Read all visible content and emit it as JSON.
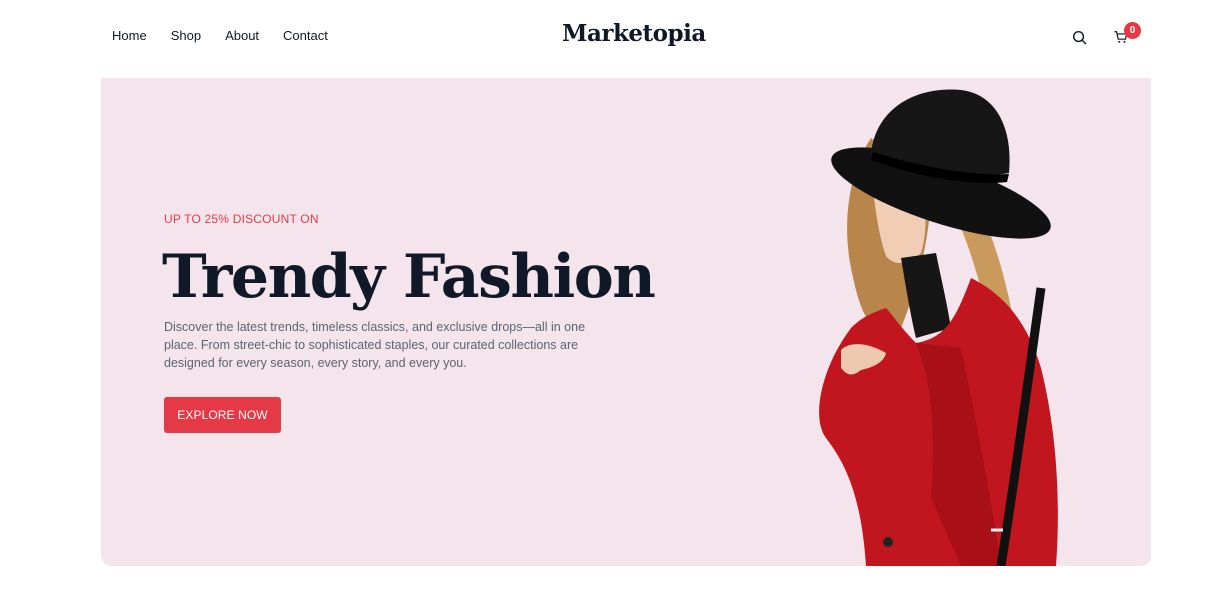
{
  "header": {
    "nav": [
      {
        "label": "Home"
      },
      {
        "label": "Shop"
      },
      {
        "label": "About"
      },
      {
        "label": "Contact"
      }
    ],
    "logo": "Marketopia",
    "search_icon": "search-icon",
    "cart_icon": "cart-icon",
    "cart_count": "0"
  },
  "hero": {
    "kicker": "UP TO 25% DISCOUNT ON",
    "title": "Trendy Fashion",
    "description": "Discover the latest trends, timeless classics, and exclusive drops—all in one place. From street-chic to sophisticated staples, our curated collections are designed for every season, every story, and every you.",
    "cta_label": "EXPLORE NOW",
    "image_alt": "Woman in black hat and red coat"
  },
  "colors": {
    "accent": "#e63946",
    "hero_bg": "#f4e5ec",
    "text_dark": "#111827",
    "text_muted": "#5b6472"
  }
}
